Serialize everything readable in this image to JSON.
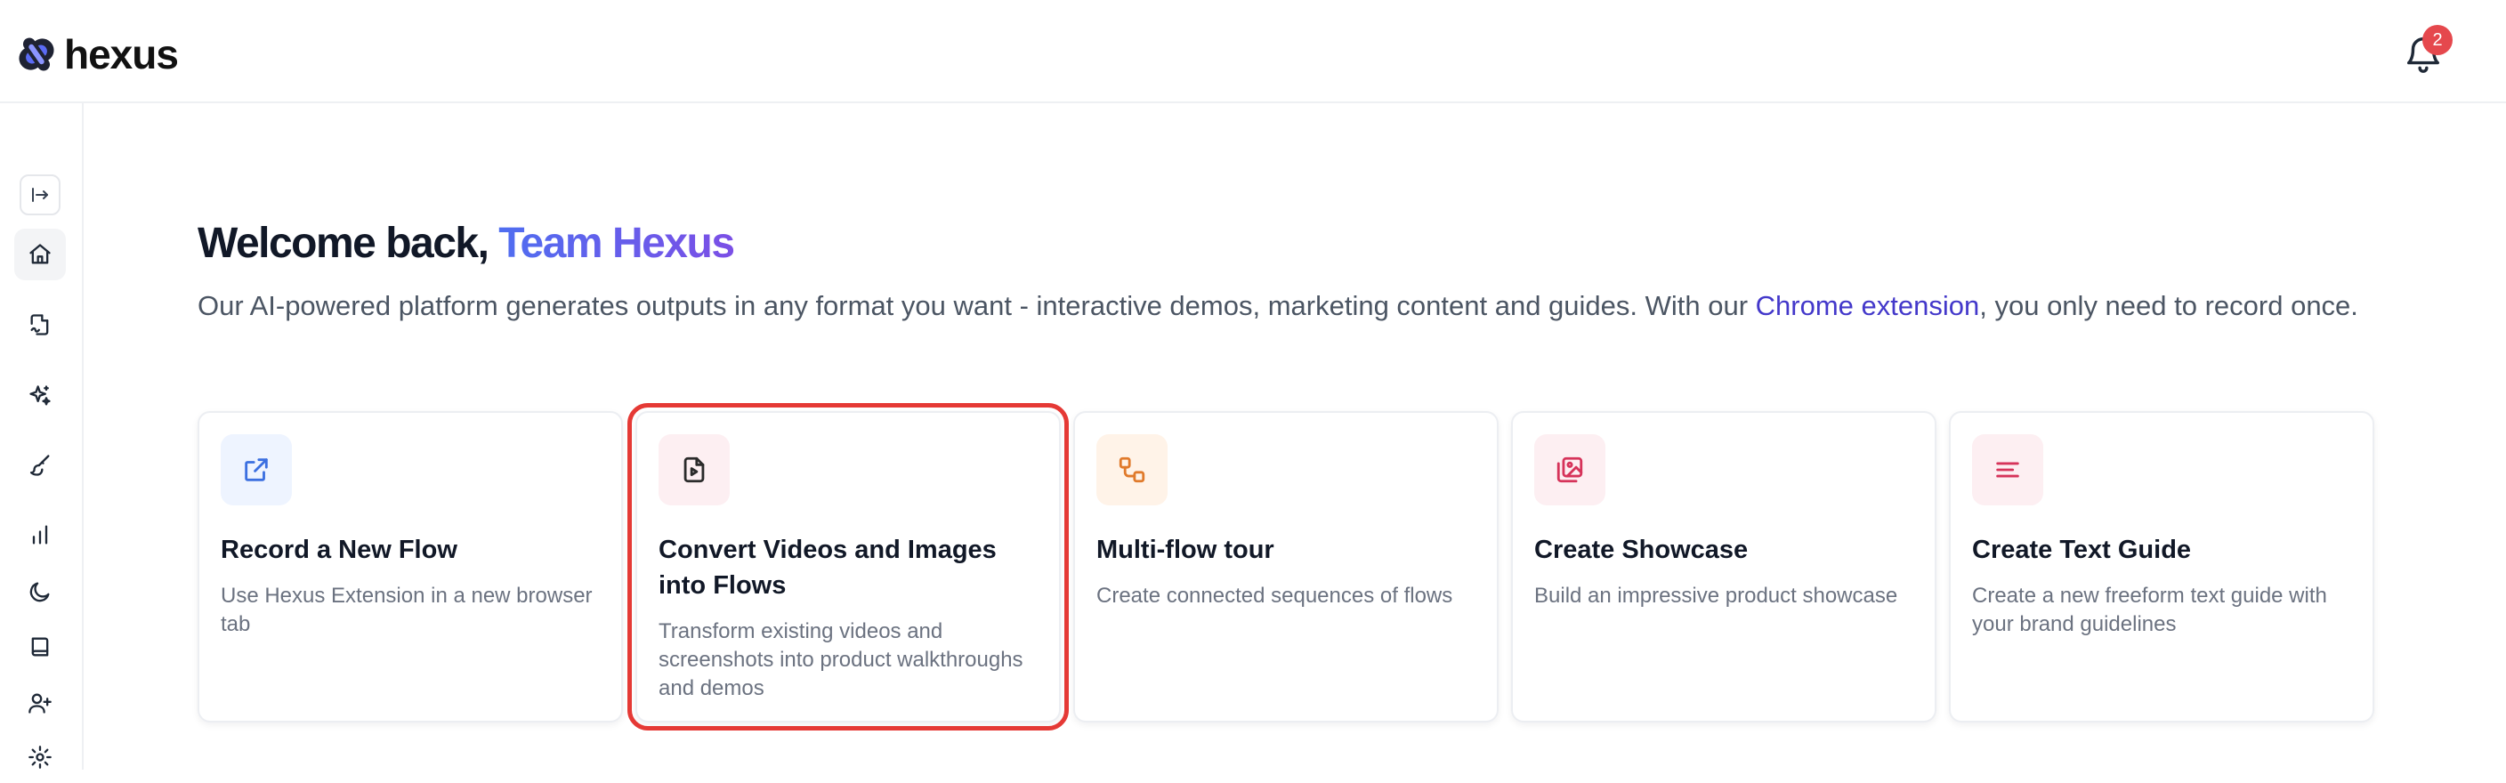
{
  "brand": {
    "name": "hexus"
  },
  "notifications": {
    "count": "2"
  },
  "welcome": {
    "greeting": "Welcome back, ",
    "team": "Team Hexus",
    "lead_before": "Our AI-powered platform generates outputs in any format you want - interactive demos, marketing content and guides. With our ",
    "link": "Chrome extension",
    "lead_after": ", you only need to record once."
  },
  "sidebar": {
    "items": [
      {
        "icon": "collapse-sidebar-icon"
      },
      {
        "icon": "home-icon"
      },
      {
        "icon": "document-sign-icon"
      },
      {
        "icon": "sparkles-icon"
      },
      {
        "icon": "brush-icon"
      },
      {
        "icon": "bar-chart-icon"
      },
      {
        "icon": "moon-icon"
      },
      {
        "icon": "book-icon"
      },
      {
        "icon": "user-plus-icon"
      },
      {
        "icon": "gear-icon"
      }
    ]
  },
  "cards": [
    {
      "title": "Record a New Flow",
      "desc": "Use Hexus Extension in a new browser tab",
      "icon": "external-link-icon",
      "icon_bg": "#eef4ff",
      "icon_color": "#3b6fe0"
    },
    {
      "title": "Convert Videos and Images into Flows",
      "desc": "Transform existing videos and screenshots into product walkthroughs and demos",
      "icon": "file-video-icon",
      "icon_bg": "#fdeff2",
      "icon_color": "#2b2b2b"
    },
    {
      "title": "Multi-flow tour",
      "desc": "Create connected sequences of flows",
      "icon": "workflow-icon",
      "icon_bg": "#fff3e8",
      "icon_color": "#e07a2b"
    },
    {
      "title": "Create Showcase",
      "desc": "Build an impressive product showcase",
      "icon": "images-icon",
      "icon_bg": "#fdeff2",
      "icon_color": "#d6335a"
    },
    {
      "title": "Create Text Guide",
      "desc": "Create a new freeform text guide with your brand guidelines",
      "icon": "text-lines-icon",
      "icon_bg": "#fdeff2",
      "icon_color": "#d6335a"
    }
  ],
  "colors": {
    "accent": "#4338ca",
    "highlight": "#e53935",
    "badge": "#e5484d"
  }
}
